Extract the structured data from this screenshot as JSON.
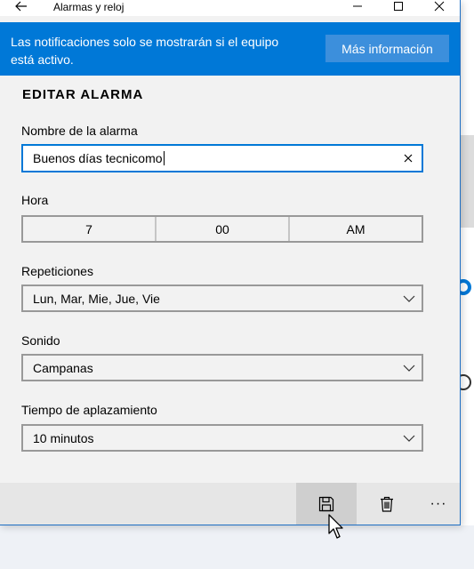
{
  "window": {
    "title": "Alarmas y reloj"
  },
  "banner": {
    "message": "Las notificaciones solo se mostrarán si el equipo está activo.",
    "more_info": "Más información"
  },
  "form": {
    "heading": "EDITAR ALARMA",
    "name_label": "Nombre de la alarma",
    "name_value": "Buenos días tecnicomo",
    "time_label": "Hora",
    "hour": "7",
    "minute": "00",
    "period": "AM",
    "repeat_label": "Repeticiones",
    "repeat_value": "Lun, Mar, Mie, Jue, Vie",
    "sound_label": "Sonido",
    "sound_value": "Campanas",
    "snooze_label": "Tiempo de aplazamiento",
    "snooze_value": "10 minutos"
  },
  "commandbar": {
    "items": [
      "save-icon",
      "delete-icon",
      "more-icon"
    ],
    "more_glyph": "···"
  },
  "colors": {
    "accent": "#0078d7",
    "banner_button": "#3c8fdc"
  }
}
